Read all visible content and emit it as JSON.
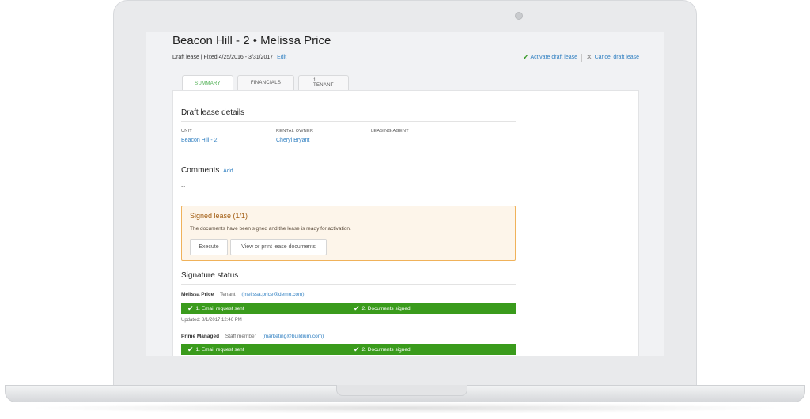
{
  "header": {
    "title": "Beacon Hill - 2 • Melissa Price",
    "meta": "Draft lease | Fixed 4/25/2016 - 3/31/2017",
    "edit_label": "Edit",
    "activate_label": "Activate draft lease",
    "cancel_label": "Cancel draft lease"
  },
  "tabs": [
    {
      "label": "SUMMARY",
      "active": true
    },
    {
      "label": "FINANCIALS",
      "active": false
    },
    {
      "label": "1 TENANT",
      "active": false
    }
  ],
  "details": {
    "title": "Draft lease details",
    "fields": [
      {
        "label": "UNIT",
        "value": "Beacon Hill - 2"
      },
      {
        "label": "RENTAL OWNER",
        "value": "Cheryl Bryant"
      },
      {
        "label": "LEASING AGENT",
        "value": ""
      }
    ]
  },
  "comments": {
    "title": "Comments",
    "add_label": "Add",
    "text": "--"
  },
  "signed": {
    "title": "Signed lease (1/1)",
    "text": "The documents have been signed and the lease is ready for activation.",
    "execute_label": "Execute",
    "view_label": "View or print lease documents"
  },
  "signature_status": {
    "title": "Signature status",
    "signers": [
      {
        "name": "Melissa Price",
        "role": "Tenant",
        "email": "(melissa.price@demo.com)",
        "step1": "1. Email request sent",
        "step2": "2. Documents signed",
        "updated": "Updated: 8/1/2017 12:46 PM"
      },
      {
        "name": "Prime Managed",
        "role": "Staff member",
        "email": "(marketing@buildium.com)",
        "step1": "1. Email request sent",
        "step2": "2. Documents signed"
      }
    ]
  },
  "colors": {
    "accent": "#2f7fc1",
    "success": "#3a9b1c",
    "warning_border": "#f0b25a",
    "warning_bg": "#fdf5ea"
  }
}
